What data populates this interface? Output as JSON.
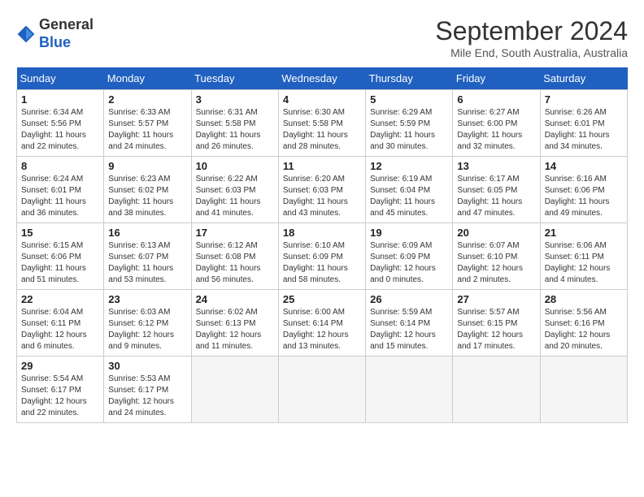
{
  "header": {
    "logo_general": "General",
    "logo_blue": "Blue",
    "month_title": "September 2024",
    "subtitle": "Mile End, South Australia, Australia"
  },
  "weekdays": [
    "Sunday",
    "Monday",
    "Tuesday",
    "Wednesday",
    "Thursday",
    "Friday",
    "Saturday"
  ],
  "weeks": [
    [
      {
        "day": "1",
        "sunrise": "6:34 AM",
        "sunset": "5:56 PM",
        "daylight": "11 hours and 22 minutes."
      },
      {
        "day": "2",
        "sunrise": "6:33 AM",
        "sunset": "5:57 PM",
        "daylight": "11 hours and 24 minutes."
      },
      {
        "day": "3",
        "sunrise": "6:31 AM",
        "sunset": "5:58 PM",
        "daylight": "11 hours and 26 minutes."
      },
      {
        "day": "4",
        "sunrise": "6:30 AM",
        "sunset": "5:58 PM",
        "daylight": "11 hours and 28 minutes."
      },
      {
        "day": "5",
        "sunrise": "6:29 AM",
        "sunset": "5:59 PM",
        "daylight": "11 hours and 30 minutes."
      },
      {
        "day": "6",
        "sunrise": "6:27 AM",
        "sunset": "6:00 PM",
        "daylight": "11 hours and 32 minutes."
      },
      {
        "day": "7",
        "sunrise": "6:26 AM",
        "sunset": "6:01 PM",
        "daylight": "11 hours and 34 minutes."
      }
    ],
    [
      {
        "day": "8",
        "sunrise": "6:24 AM",
        "sunset": "6:01 PM",
        "daylight": "11 hours and 36 minutes."
      },
      {
        "day": "9",
        "sunrise": "6:23 AM",
        "sunset": "6:02 PM",
        "daylight": "11 hours and 38 minutes."
      },
      {
        "day": "10",
        "sunrise": "6:22 AM",
        "sunset": "6:03 PM",
        "daylight": "11 hours and 41 minutes."
      },
      {
        "day": "11",
        "sunrise": "6:20 AM",
        "sunset": "6:03 PM",
        "daylight": "11 hours and 43 minutes."
      },
      {
        "day": "12",
        "sunrise": "6:19 AM",
        "sunset": "6:04 PM",
        "daylight": "11 hours and 45 minutes."
      },
      {
        "day": "13",
        "sunrise": "6:17 AM",
        "sunset": "6:05 PM",
        "daylight": "11 hours and 47 minutes."
      },
      {
        "day": "14",
        "sunrise": "6:16 AM",
        "sunset": "6:06 PM",
        "daylight": "11 hours and 49 minutes."
      }
    ],
    [
      {
        "day": "15",
        "sunrise": "6:15 AM",
        "sunset": "6:06 PM",
        "daylight": "11 hours and 51 minutes."
      },
      {
        "day": "16",
        "sunrise": "6:13 AM",
        "sunset": "6:07 PM",
        "daylight": "11 hours and 53 minutes."
      },
      {
        "day": "17",
        "sunrise": "6:12 AM",
        "sunset": "6:08 PM",
        "daylight": "11 hours and 56 minutes."
      },
      {
        "day": "18",
        "sunrise": "6:10 AM",
        "sunset": "6:09 PM",
        "daylight": "11 hours and 58 minutes."
      },
      {
        "day": "19",
        "sunrise": "6:09 AM",
        "sunset": "6:09 PM",
        "daylight": "12 hours and 0 minutes."
      },
      {
        "day": "20",
        "sunrise": "6:07 AM",
        "sunset": "6:10 PM",
        "daylight": "12 hours and 2 minutes."
      },
      {
        "day": "21",
        "sunrise": "6:06 AM",
        "sunset": "6:11 PM",
        "daylight": "12 hours and 4 minutes."
      }
    ],
    [
      {
        "day": "22",
        "sunrise": "6:04 AM",
        "sunset": "6:11 PM",
        "daylight": "12 hours and 6 minutes."
      },
      {
        "day": "23",
        "sunrise": "6:03 AM",
        "sunset": "6:12 PM",
        "daylight": "12 hours and 9 minutes."
      },
      {
        "day": "24",
        "sunrise": "6:02 AM",
        "sunset": "6:13 PM",
        "daylight": "12 hours and 11 minutes."
      },
      {
        "day": "25",
        "sunrise": "6:00 AM",
        "sunset": "6:14 PM",
        "daylight": "12 hours and 13 minutes."
      },
      {
        "day": "26",
        "sunrise": "5:59 AM",
        "sunset": "6:14 PM",
        "daylight": "12 hours and 15 minutes."
      },
      {
        "day": "27",
        "sunrise": "5:57 AM",
        "sunset": "6:15 PM",
        "daylight": "12 hours and 17 minutes."
      },
      {
        "day": "28",
        "sunrise": "5:56 AM",
        "sunset": "6:16 PM",
        "daylight": "12 hours and 20 minutes."
      }
    ],
    [
      {
        "day": "29",
        "sunrise": "5:54 AM",
        "sunset": "6:17 PM",
        "daylight": "12 hours and 22 minutes."
      },
      {
        "day": "30",
        "sunrise": "5:53 AM",
        "sunset": "6:17 PM",
        "daylight": "12 hours and 24 minutes."
      },
      null,
      null,
      null,
      null,
      null
    ]
  ],
  "labels": {
    "sunrise": "Sunrise:",
    "sunset": "Sunset:",
    "daylight": "Daylight:"
  }
}
